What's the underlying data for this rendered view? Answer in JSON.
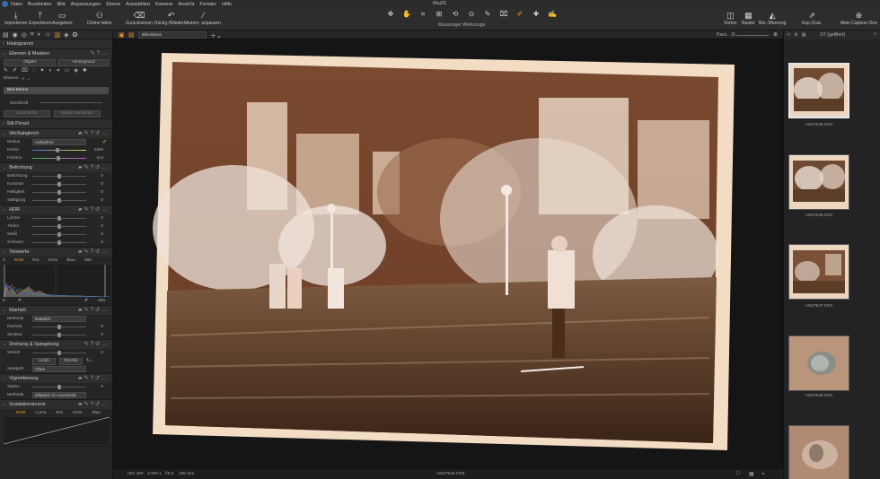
{
  "menubar": {
    "items": [
      "Datei",
      "Bearbeiten",
      "Bild",
      "Anpassungen",
      "Ebene",
      "Auswählen",
      "Kamera",
      "Ansicht",
      "Fenster",
      "Hilfe"
    ],
    "window_title": "Mai25"
  },
  "toolbar": {
    "import": "Importieren",
    "export": "Exportieren",
    "output": "Ausgeben",
    "online": "Online teilen",
    "undo": "Zurücksetzen",
    "undo_redo": "Rückg./Wiederh.",
    "auto": "Autom. anpassen",
    "tools_label": "Mauszeiger Werkzeuge",
    "compare": "Vorher",
    "grid": "Raster",
    "warning": "Bel.-Warnung",
    "copy_apply": "Kop./Zuw.",
    "capture": "Mein Capture One"
  },
  "left": {
    "histogram": "Histogramm",
    "layers_masks": "Ebenen & Masken",
    "object": "Objekt",
    "background": "Hintergrund",
    "layers": "Ebenen",
    "layer_name": "Bild-Ebene",
    "opacity": "Deckkraft",
    "brightness_mask": "Luminanzb.",
    "mask_btn": "Maske verbinden",
    "style_brush": "Stil-Pinsel",
    "white_balance": "Weißabgleich",
    "wb_mode_label": "Modus",
    "wb_mode": "Aufnahme",
    "kelvin_label": "Kelvin",
    "kelvin": "4406",
    "tint_label": "Farbton",
    "tint": "-6,3",
    "exposure": "Belichtung",
    "exposure_rows": [
      {
        "label": "Belichtung",
        "value": "0"
      },
      {
        "label": "Kontrast",
        "value": "0"
      },
      {
        "label": "Helligkeit",
        "value": "0"
      },
      {
        "label": "Sättigung",
        "value": "0"
      }
    ],
    "hdr": "HDR",
    "hdr_rows": [
      {
        "label": "Lichter",
        "value": "0"
      },
      {
        "label": "Tiefen",
        "value": "0"
      },
      {
        "label": "Weiß",
        "value": "0"
      },
      {
        "label": "Schwarz",
        "value": "0"
      }
    ],
    "levels": "Tonwerte",
    "levels_tabs": [
      "RGB",
      "Rot",
      "Grün",
      "Blau"
    ],
    "levels_min": "0",
    "levels_max": "255",
    "levels_out_min": "0",
    "levels_out_max": "255",
    "clarity": "Klarheit",
    "clarity_method_label": "Methode",
    "clarity_method": "Natürlich",
    "clarity_rows": [
      {
        "label": "Klarheit",
        "value": "0"
      },
      {
        "label": "Struktur",
        "value": "0"
      }
    ],
    "rotation": "Drehung & Spiegelung",
    "angle_label": "Winkel",
    "angle": "0",
    "left_btn": "Links",
    "right_btn": "Rechts",
    "mirror_label": "Spiegeln",
    "mirror": "Ohne",
    "vignette": "Vignettierung",
    "strength_label": "Stärke",
    "strength": "0",
    "vig_method_label": "Methode",
    "vig_method": "Elliptisch im Ausschnitt",
    "curve": "Gradationskurve",
    "curve_tabs": [
      "RGB",
      "Luma",
      "Rot",
      "Grün",
      "Blau"
    ]
  },
  "viewer": {
    "tab": "Bild-Ebene",
    "pass": "Pass.",
    "status_iso": "ISO 400",
    "status_shutter": "1/100 s",
    "status_aperture": "f/5,6",
    "status_focal": "100 mm",
    "status_file": "AI527545.CR3"
  },
  "browser": {
    "count": "1/7 (gefiltert)",
    "thumbs": [
      "AI527545.CR3",
      "AI527546.CR3",
      "AI527547.CR3",
      "AI527548.CR3",
      ""
    ]
  },
  "colors": {
    "accent": "#e2952e",
    "panel": "#252525",
    "film_base": "#f3dcc4"
  }
}
